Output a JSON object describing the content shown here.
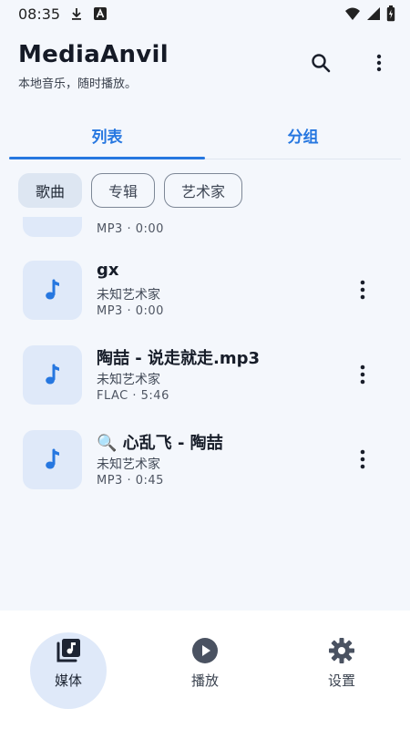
{
  "status_bar": {
    "time": "08:35",
    "icons": [
      "download-icon",
      "a-box-icon",
      "wifi-icon",
      "cellular-icon",
      "battery-icon"
    ]
  },
  "header": {
    "title": "MediaAnvil",
    "subtitle": "本地音乐，随时播放。",
    "actions": [
      "search-icon",
      "more-vert-icon"
    ]
  },
  "tabs": [
    {
      "label": "列表",
      "active": true
    },
    {
      "label": "分组",
      "active": false
    }
  ],
  "chips": [
    {
      "label": "歌曲",
      "active": true
    },
    {
      "label": "专辑",
      "active": false
    },
    {
      "label": "艺术家",
      "active": false
    }
  ],
  "partial_item": {
    "meta": "MP3 · 0:00"
  },
  "songs": [
    {
      "title": "gx",
      "artist": "未知艺术家",
      "meta": "MP3 · 0:00",
      "icon": "music-note-icon"
    },
    {
      "title": "陶喆 - 说走就走.mp3",
      "artist": "未知艺术家",
      "meta": "FLAC · 5:46",
      "icon": "music-note-icon"
    },
    {
      "title": "🔍 心乱飞 - 陶喆",
      "artist": "未知艺术家",
      "meta": "MP3 · 0:45",
      "icon": "music-note-icon"
    }
  ],
  "bottom_nav": [
    {
      "label": "媒体",
      "active": true,
      "icon": "library-music-icon"
    },
    {
      "label": "播放",
      "active": false,
      "icon": "play-circle-icon"
    },
    {
      "label": "设置",
      "active": false,
      "icon": "settings-icon"
    }
  ],
  "colors": {
    "accent": "#2677e0",
    "background": "#f4f7fc",
    "thumb": "#dfe9f9",
    "nav_bg": "#ffffff",
    "text_primary": "#171d29"
  }
}
